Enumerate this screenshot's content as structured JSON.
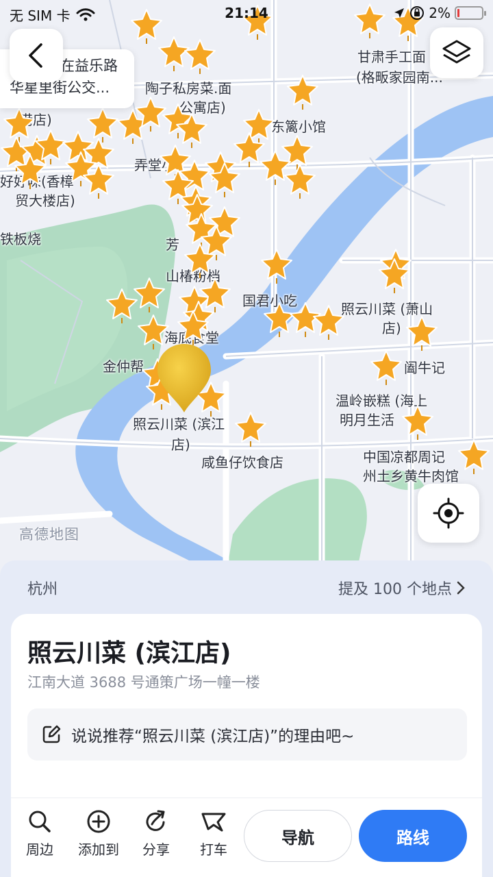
{
  "status_bar": {
    "carrier": "无 SIM 卡",
    "time": "21:14",
    "battery": "2%"
  },
  "map": {
    "callout_lines": [
      "在益乐路",
      "华星里街公交..."
    ],
    "watermark": "高德地图",
    "labels": [
      "陶子私房菜.面",
      "公寓店)",
      "甘肃手工面",
      "(格畈家园南...",
      "港店)",
      "东篱小馆",
      "弄堂小",
      "好好味(香樟",
      "贸大楼店)",
      "铁板烧",
      "芳",
      "山椿粉档",
      "国君小吃",
      "照云川菜 (萧山",
      "店)",
      "海底食堂",
      "金仲帮",
      "阖牛记",
      "温岭嵌糕 (海上",
      "明月生活",
      "照云川菜 (滨江",
      "店)",
      "咸鱼仔饮食店",
      "中国凉都周记",
      "州土乡黄牛肉馆"
    ]
  },
  "sheet": {
    "city": "杭州",
    "mentions": "提及 100 个地点",
    "place_title": "照云川菜 (滨江店)",
    "address": "江南大道 3688 号通策广场一幢一楼",
    "reason_prompt": "说说推荐“照云川菜 (滨江店)”的理由吧~",
    "actions": {
      "nearby": "周边",
      "add_to": "添加到",
      "share": "分享",
      "taxi": "打车",
      "navigate": "导航",
      "route": "路线"
    }
  },
  "colors": {
    "accent": "#2f7bf5",
    "star": "#f5a623",
    "water": "#9ec3f4",
    "park": "#9fd3b4"
  }
}
